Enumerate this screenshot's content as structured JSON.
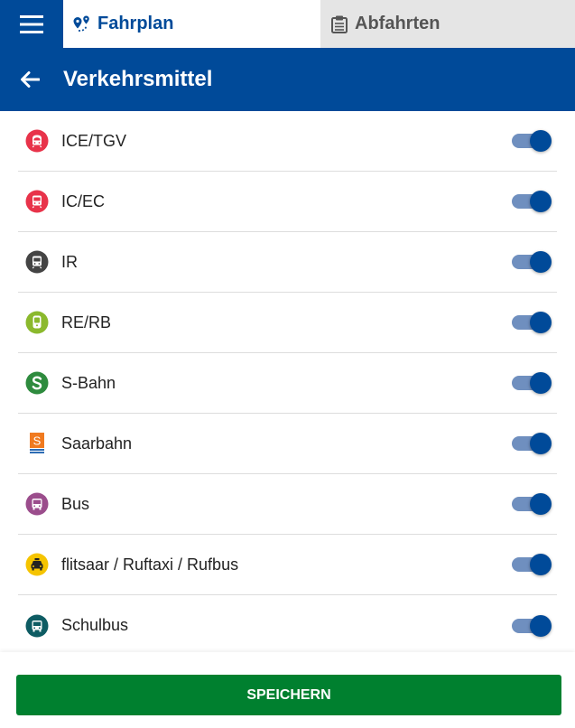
{
  "top_nav": {
    "tabs": [
      {
        "label": "Fahrplan",
        "icon": "route-icon",
        "active": true
      },
      {
        "label": "Abfahrten",
        "icon": "departures-icon",
        "active": false
      }
    ]
  },
  "header": {
    "title": "Verkehrsmittel"
  },
  "transport_modes": [
    {
      "label": "ICE/TGV",
      "icon": "ice-train-icon",
      "icon_color": "#e8334a",
      "enabled": true
    },
    {
      "label": "IC/EC",
      "icon": "ic-train-icon",
      "icon_color": "#e8334a",
      "enabled": true
    },
    {
      "label": "IR",
      "icon": "ir-train-icon",
      "icon_color": "#444444",
      "enabled": true
    },
    {
      "label": "RE/RB",
      "icon": "regional-train-icon",
      "icon_color": "#8bb92d",
      "enabled": true
    },
    {
      "label": "S-Bahn",
      "icon": "s-bahn-icon",
      "icon_color": "#2e8b3e",
      "enabled": true
    },
    {
      "label": "Saarbahn",
      "icon": "saarbahn-icon",
      "icon_color": "#f07a1f",
      "enabled": true
    },
    {
      "label": "Bus",
      "icon": "bus-icon",
      "icon_color": "#9b4d8c",
      "enabled": true
    },
    {
      "label": "flitsaar / Ruftaxi / Rufbus",
      "icon": "taxi-icon",
      "icon_color": "#f5c400",
      "enabled": true
    },
    {
      "label": "Schulbus",
      "icon": "school-bus-icon",
      "icon_color": "#0e5c63",
      "enabled": true
    }
  ],
  "footer": {
    "save_label": "SPEICHERN"
  },
  "colors": {
    "brand_blue": "#004a99",
    "save_green": "#00802f",
    "toggle_track": "#6f8fbf"
  }
}
